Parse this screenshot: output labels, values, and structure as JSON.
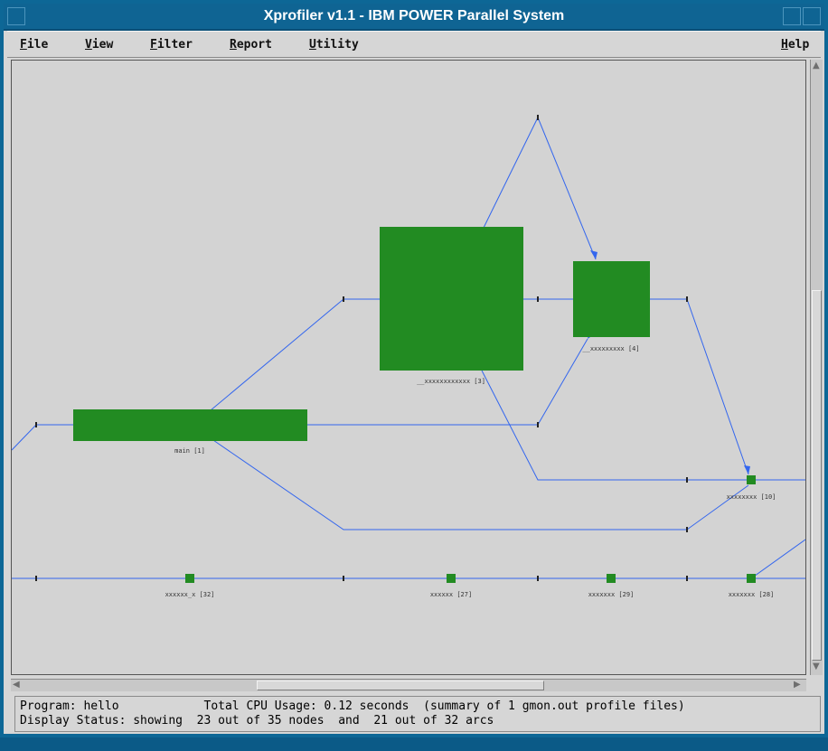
{
  "window": {
    "title": "Xprofiler v1.1 - IBM POWER Parallel System"
  },
  "menubar": {
    "items": [
      "File",
      "View",
      "Filter",
      "Report",
      "Utility"
    ],
    "help": "Help"
  },
  "status": {
    "program_line": "Program: hello            Total CPU Usage: 0.12 seconds  (summary of 1 gmon.out profile files)",
    "display_line": "Display Status: showing  23 out of 35 nodes  and  21 out of 32 arcs"
  },
  "graph": {
    "node_color": "#228b22",
    "edge_color": "#3366ee",
    "nodes": [
      {
        "id": "main",
        "label": "main [1]"
      },
      {
        "id": "large",
        "label": "__xxxxxxxxxxxx [3]"
      },
      {
        "id": "medium",
        "label": "__xxxxxxxxx [4]"
      },
      {
        "id": "small-right",
        "label": "xxxxxxxx [10]"
      },
      {
        "id": "bottom-1",
        "label": "xxxxxx_x [32]"
      },
      {
        "id": "bottom-2",
        "label": "xxxxxx [27]"
      },
      {
        "id": "bottom-3",
        "label": "xxxxxxx [29]"
      },
      {
        "id": "bottom-4",
        "label": "xxxxxxx [28]"
      }
    ]
  }
}
